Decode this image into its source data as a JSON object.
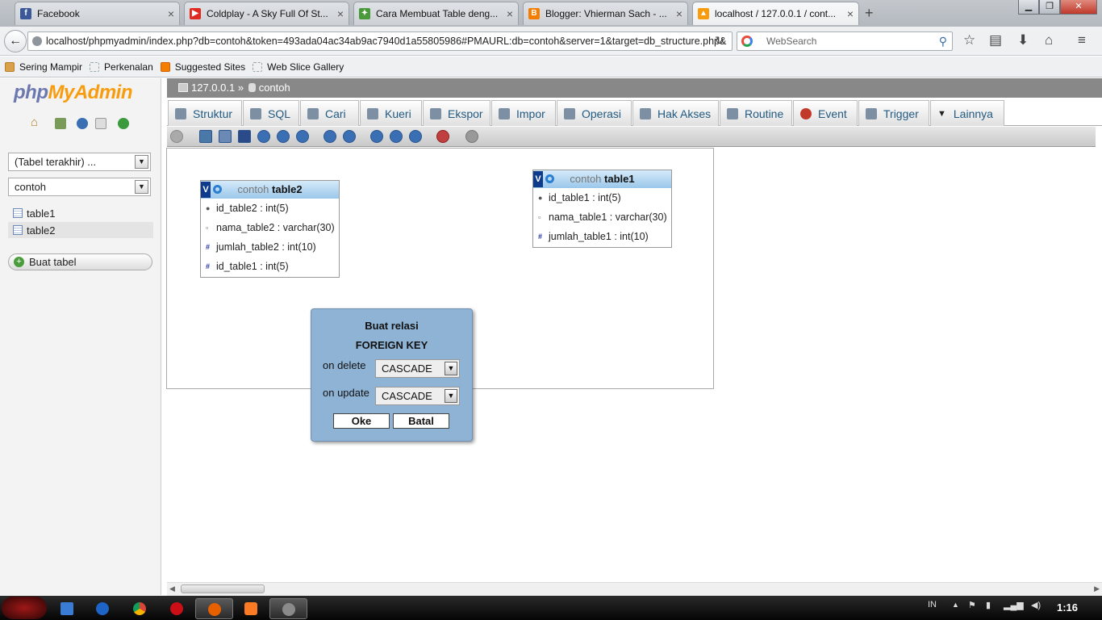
{
  "browser": {
    "tabs": [
      {
        "title": "Facebook",
        "favicon": "facebook-icon",
        "color": "#3b5998"
      },
      {
        "title": "Coldplay - A Sky Full Of St...",
        "favicon": "youtube-icon",
        "color": "#e02a20"
      },
      {
        "title": "Cara Membuat Table deng...",
        "favicon": "site-icon",
        "color": "#4a9a3c"
      },
      {
        "title": "Blogger: Vhierman Sach - ...",
        "favicon": "blogger-icon",
        "color": "#f57d00"
      },
      {
        "title": "localhost / 127.0.0.1 / cont...",
        "favicon": "phpmyadmin-icon",
        "color": "#f89c0e"
      }
    ],
    "new_tab": "+",
    "url": "localhost/phpmyadmin/index.php?db=contoh&token=493ada04ac34ab9ac7940d1a55805986#PMAURL:db=contoh&server=1&target=db_structure.php&",
    "search_placeholder": "WebSearch",
    "bookmarks": [
      "Sering Mampir",
      "Perkenalan",
      "Suggested Sites",
      "Web Slice Gallery"
    ]
  },
  "sidebar": {
    "logo_php": "php",
    "logo_myadmin": "MyAdmin",
    "recent_select": "(Tabel terakhir) ...",
    "db_select": "contoh",
    "tables": [
      "table1",
      "table2"
    ],
    "create_table": "Buat tabel"
  },
  "breadcrumb": {
    "server": "127.0.0.1",
    "separator": "»",
    "database": "contoh"
  },
  "menu": {
    "tabs": [
      "Struktur",
      "SQL",
      "Cari",
      "Kueri",
      "Ekspor",
      "Impor",
      "Operasi",
      "Hak Akses",
      "Routine",
      "Event",
      "Trigger",
      "Lainnya"
    ]
  },
  "designer": {
    "table2": {
      "db": "contoh",
      "name": "table2",
      "v": "V",
      "columns": [
        {
          "name": "id_table2",
          "type": "int(5)",
          "icon": "key-icon"
        },
        {
          "name": "nama_table2",
          "type": "varchar(30)",
          "icon": "field-icon"
        },
        {
          "name": "jumlah_table2",
          "type": "int(10)",
          "icon": "hash-icon"
        },
        {
          "name": "id_table1",
          "type": "int(5)",
          "icon": "hash-icon"
        }
      ]
    },
    "table1": {
      "db": "contoh",
      "name": "table1",
      "v": "V",
      "columns": [
        {
          "name": "id_table1",
          "type": "int(5)",
          "icon": "key-icon"
        },
        {
          "name": "nama_table1",
          "type": "varchar(30)",
          "icon": "field-icon"
        },
        {
          "name": "jumlah_table1",
          "type": "int(10)",
          "icon": "hash-icon"
        }
      ]
    }
  },
  "dialog": {
    "title": "Buat relasi",
    "subtitle": "FOREIGN KEY",
    "on_delete_label": "on delete",
    "on_delete_value": "CASCADE",
    "on_update_label": "on update",
    "on_update_value": "CASCADE",
    "ok": "Oke",
    "cancel": "Batal"
  },
  "taskbar": {
    "lang": "IN",
    "clock": "1:16"
  },
  "colors": {
    "accent": "#235a81",
    "dialog_bg": "#8fb3d5",
    "header_gray": "#888888"
  }
}
